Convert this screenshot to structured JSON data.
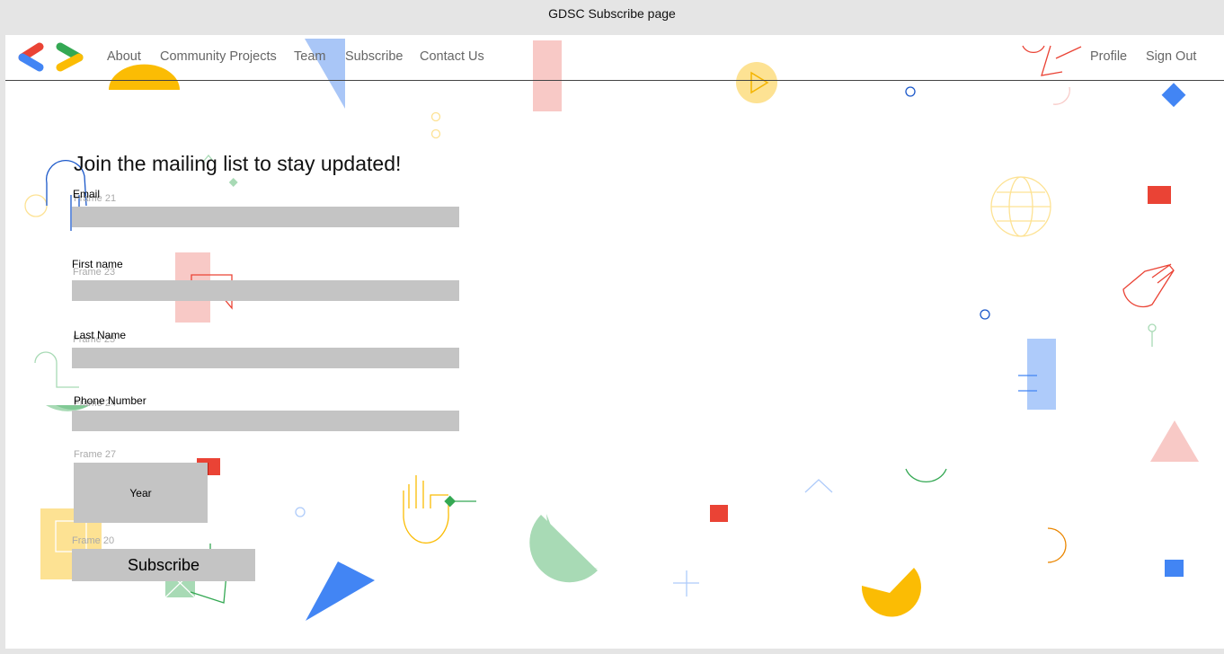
{
  "window": {
    "title": "GDSC Subscribe page"
  },
  "nav": {
    "logo_icon": "gdsc-logo-icon",
    "links": [
      "About",
      "Community Projects",
      "Team",
      "Subscribe",
      "Contact Us"
    ],
    "right_links": [
      "Profile",
      "Sign Out"
    ]
  },
  "form": {
    "heading": "Join the mailing list to stay updated!",
    "email": {
      "label": "Email",
      "frame": "Frame 21",
      "value": ""
    },
    "first_name": {
      "label": "First name",
      "frame": "Frame 23",
      "value": ""
    },
    "last_name": {
      "label": "Last Name",
      "frame": "Frame 25",
      "value": ""
    },
    "phone": {
      "label": "Phone Number",
      "frame": "Frame 24",
      "value": ""
    },
    "year": {
      "frame": "Frame 27",
      "label": "Year"
    },
    "subscribe": {
      "frame": "Frame 20",
      "label": "Subscribe"
    }
  },
  "colors": {
    "red": "#ea4335",
    "green": "#34a853",
    "yellow": "#fbbc04",
    "blue": "#4285f4",
    "field": "#c4c4c4"
  }
}
